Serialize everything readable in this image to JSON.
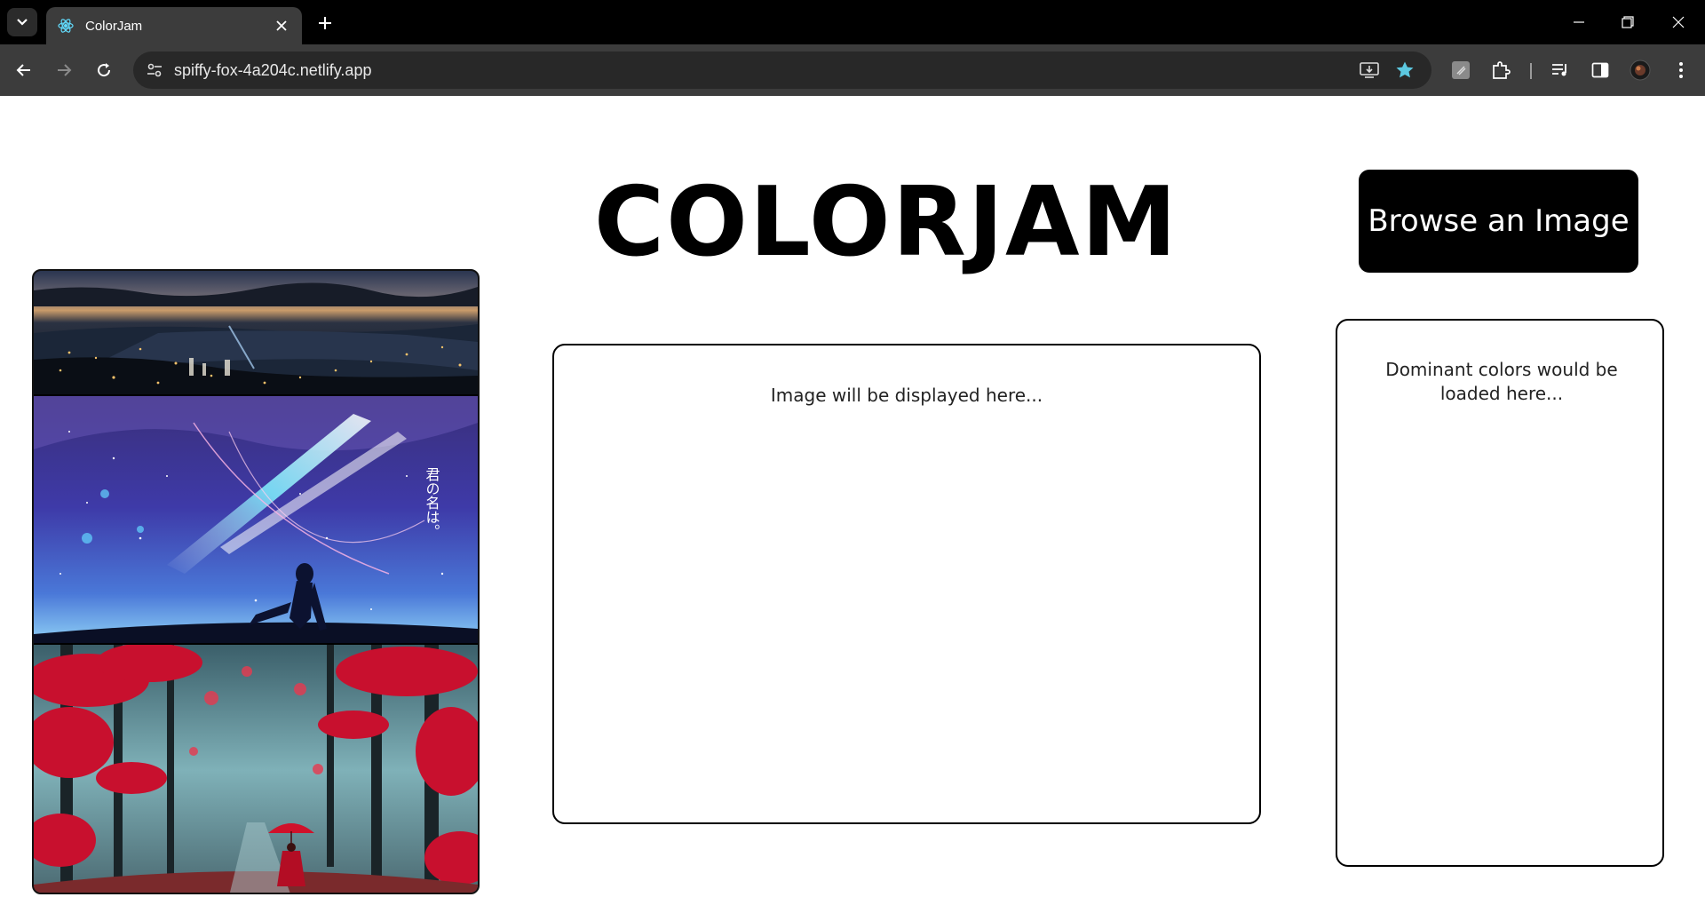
{
  "browser": {
    "tab_title": "ColorJam",
    "url": "spiffy-fox-4a204c.netlify.app"
  },
  "page": {
    "title": "COLORJAM",
    "browse_button": "Browse an Image",
    "image_placeholder": "Image will be displayed here...",
    "colors_placeholder": "Dominant colors would be loaded here...",
    "gallery": [
      {
        "name": "night-city-bay",
        "overlay_text": ""
      },
      {
        "name": "your-name-starry-sky",
        "overlay_text": "君の名は。 Your Name."
      },
      {
        "name": "red-forest-umbrella",
        "overlay_text": ""
      }
    ]
  },
  "colors": {
    "chrome_dark": "#000000",
    "toolbar": "#3c3c3c",
    "omnibox": "#282828",
    "accent_star": "#5cc8e0",
    "button_bg": "#000000",
    "button_text": "#ffffff"
  }
}
